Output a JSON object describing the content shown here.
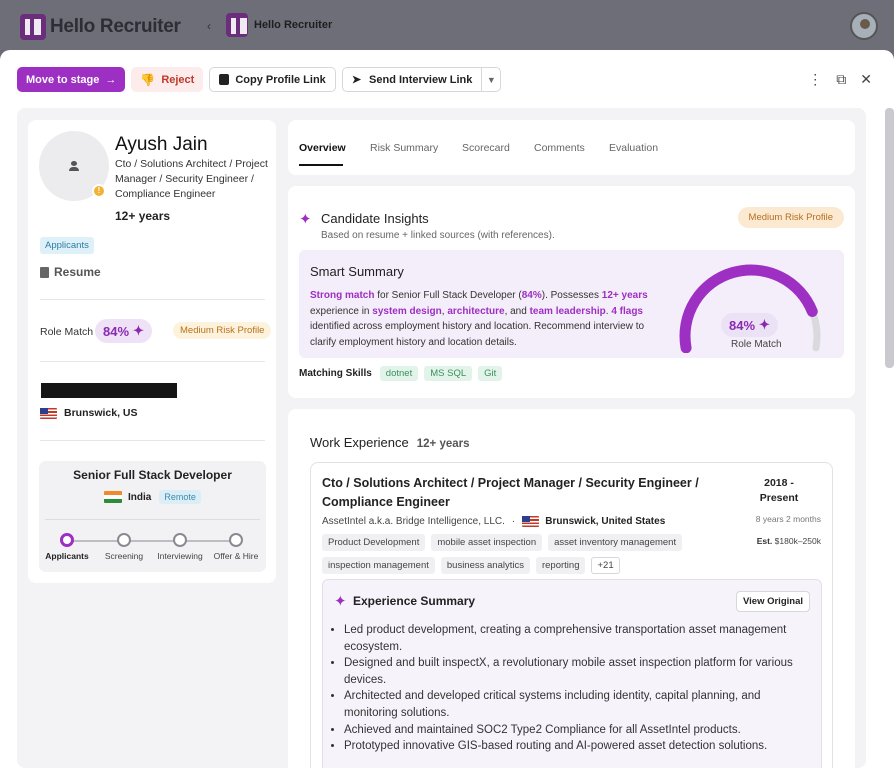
{
  "app": {
    "brand": "Hello Recruiter",
    "brand_small": "Hello Recruiter",
    "collapse_icon": "chevron-left-icon"
  },
  "toolbar": {
    "move_to_stage": "Move to stage",
    "reject": "Reject",
    "copy_profile_link": "Copy Profile Link",
    "send_interview_link": "Send Interview Link"
  },
  "candidate": {
    "name": "Ayush Jain",
    "title": "Cto / Solutions Architect / Project Manager / Security Engineer / Compliance Engineer",
    "years": "12+ years",
    "status_chip": "Applicants",
    "resume_label": "Resume",
    "role_match_label": "Role Match",
    "role_match_value": "84%",
    "risk_label": "Medium Risk Profile",
    "location": "Brunswick, US"
  },
  "job": {
    "title": "Senior Full Stack Developer",
    "location": "India",
    "work_mode": "Remote",
    "stages": [
      "Applicants",
      "Screening",
      "Interviewing",
      "Offer & Hire"
    ],
    "active_stage_index": 0
  },
  "tabs": [
    "Overview",
    "Risk Summary",
    "Scorecard",
    "Comments",
    "Evaluation"
  ],
  "insights": {
    "title": "Candidate Insights",
    "subtitle": "Based on resume + linked sources (with references).",
    "risk_pill": "Medium Risk Profile",
    "smart_summary_title": "Smart Summary",
    "smart_summary": {
      "p1": "Strong match",
      "p2": " for Senior Full Stack Developer (",
      "p3": "84%",
      "p4": "). Possesses ",
      "p5": "12+ years",
      "p6": " experience in ",
      "p7": "system design",
      "p8": ", ",
      "p9": "architecture",
      "p10": ", and ",
      "p11": "team leadership",
      "p12": ". ",
      "p13": "4 flags",
      "p14": " identified across employment history and location. Recommend interview to clarify employment history and location details."
    },
    "gauge_value": "84%",
    "gauge_fraction": 0.84,
    "gauge_label": "Role Match",
    "matching_skills_label": "Matching Skills",
    "skills": [
      "dotnet",
      "MS SQL",
      "Git"
    ]
  },
  "work": {
    "title": "Work Experience",
    "years": "12+ years",
    "role": "Cto / Solutions Architect / Project Manager / Security Engineer / Compliance Engineer",
    "date": "2018 - Present",
    "company": "AssetIntel a.k.a. Bridge Intelligence, LLC.",
    "separator": "·",
    "location": "Brunswick, United States",
    "duration": "8 years 2 months",
    "salary_prefix": "Est.",
    "salary": "$180k–250k",
    "tags": [
      "Product Development",
      "mobile asset inspection",
      "asset inventory management",
      "inspection management",
      "business analytics",
      "reporting",
      "+21"
    ],
    "summary_title": "Experience Summary",
    "view_original": "View Original",
    "summary_points": [
      "Led product development, creating a comprehensive transportation asset management ecosystem.",
      "Designed and built inspectX, a revolutionary mobile asset inspection platform for various devices.",
      "Architected and developed critical systems including identity, capital planning, and monitoring solutions.",
      "Achieved and maintained SOC2 Type2 Compliance for all AssetIntel products.",
      "Prototyped innovative GIS-based routing and AI-powered asset detection solutions."
    ]
  },
  "colors": {
    "accent": "#9d2fc2",
    "reject": "#c0392b",
    "risk": "#b5701f"
  }
}
